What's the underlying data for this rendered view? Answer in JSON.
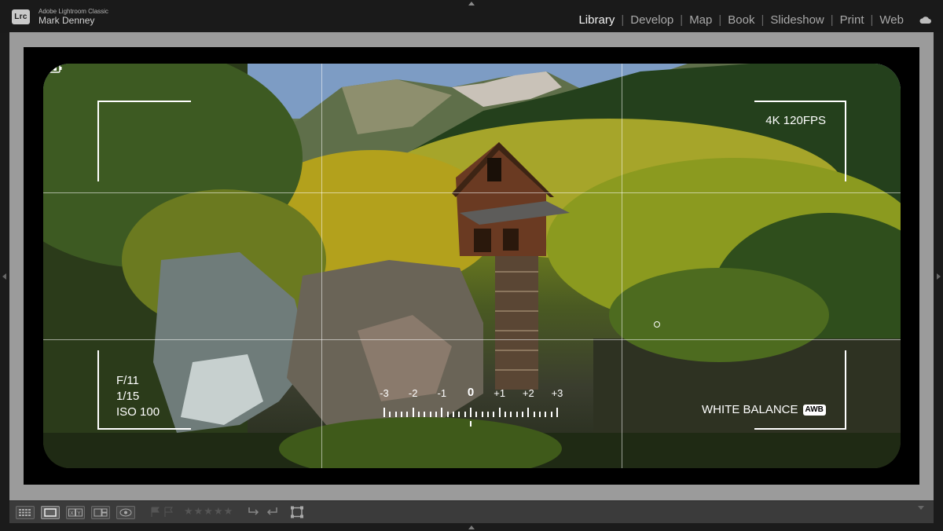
{
  "header": {
    "app_name": "Adobe Lightroom Classic",
    "user_name": "Mark Denney",
    "logo_text": "Lrc",
    "modules": [
      {
        "label": "Library",
        "active": true
      },
      {
        "label": "Develop",
        "active": false
      },
      {
        "label": "Map",
        "active": false
      },
      {
        "label": "Book",
        "active": false
      },
      {
        "label": "Slideshow",
        "active": false
      },
      {
        "label": "Print",
        "active": false
      },
      {
        "label": "Web",
        "active": false
      }
    ],
    "separator": "|"
  },
  "photo": {
    "exif": {
      "aperture": "F/11",
      "shutter": "1/15",
      "iso": "ISO 100"
    },
    "video_mode": "4K 120FPS",
    "white_balance_label": "WHITE BALANCE",
    "white_balance_badge": "AWB",
    "exposure_scale": [
      "-3",
      "-2",
      "-1",
      "0",
      "+1",
      "+2",
      "+3"
    ]
  },
  "toolbar": {
    "rating_stars": "★★★★★"
  },
  "colors": {
    "background": "#1b1b1b",
    "workspace": "#9b9b9b",
    "toolbar": "#3b3b3b",
    "active_module": "#f2f2f2",
    "inactive_module": "#a9a9a9"
  }
}
